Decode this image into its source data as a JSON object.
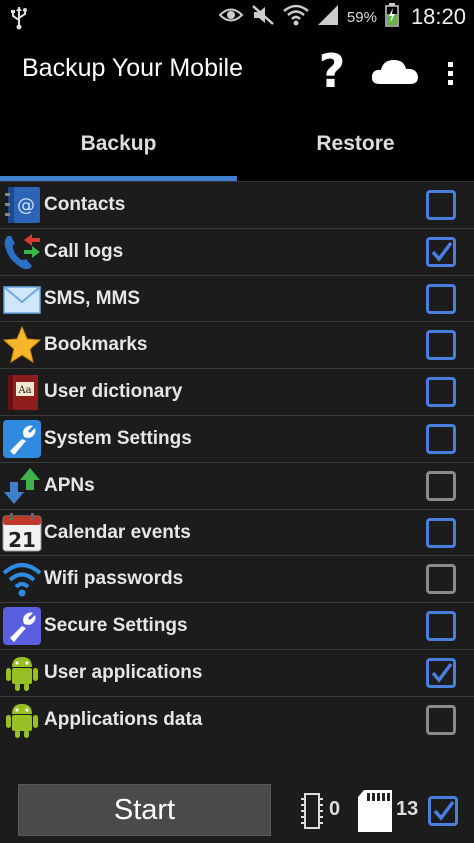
{
  "status_bar": {
    "battery_pct": "59%",
    "time": "18:20",
    "icons": [
      "usb-icon",
      "eye-icon",
      "mute-icon",
      "wifi-icon",
      "signal-icon",
      "battery-icon"
    ]
  },
  "action_bar": {
    "title": "Backup Your Mobile",
    "help_glyph": "?",
    "icons": [
      "help-icon",
      "cloud-icon",
      "overflow-menu-icon"
    ]
  },
  "tabs": [
    {
      "label": "Backup",
      "selected": true
    },
    {
      "label": "Restore",
      "selected": false
    }
  ],
  "items": [
    {
      "label": "Contacts",
      "icon": "contacts-book-icon",
      "checked": false,
      "enabled": true
    },
    {
      "label": "Call logs",
      "icon": "call-log-icon",
      "checked": true,
      "enabled": true
    },
    {
      "label": "SMS, MMS",
      "icon": "envelope-icon",
      "checked": false,
      "enabled": true
    },
    {
      "label": "Bookmarks",
      "icon": "star-icon",
      "checked": false,
      "enabled": true
    },
    {
      "label": "User dictionary",
      "icon": "dictionary-icon",
      "checked": false,
      "enabled": true
    },
    {
      "label": "System Settings",
      "icon": "wrench-icon",
      "checked": false,
      "enabled": true
    },
    {
      "label": "APNs",
      "icon": "apn-arrows-icon",
      "checked": false,
      "enabled": false
    },
    {
      "label": "Calendar events",
      "icon": "calendar-icon",
      "checked": false,
      "enabled": true,
      "calendar_day": "21"
    },
    {
      "label": "Wifi passwords",
      "icon": "wifi-icon",
      "checked": false,
      "enabled": false
    },
    {
      "label": "Secure Settings",
      "icon": "wrench-icon",
      "checked": false,
      "enabled": true
    },
    {
      "label": "User applications",
      "icon": "android-icon",
      "checked": true,
      "enabled": true
    },
    {
      "label": "Applications data",
      "icon": "android-icon",
      "checked": false,
      "enabled": false
    }
  ],
  "bottom": {
    "start_label": "Start",
    "memory_count": "0",
    "sd_count": "13",
    "sd_checked": true
  },
  "colors": {
    "accent": "#3e7fcf",
    "checkbox_active": "#4a7fe0",
    "checkbox_disabled": "#8a8a8a",
    "list_bg": "#1c1c1c"
  }
}
